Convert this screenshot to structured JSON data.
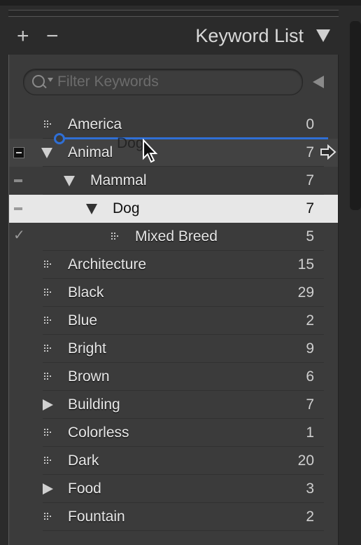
{
  "header": {
    "add_label": "+",
    "remove_label": "−",
    "title": "Keyword List"
  },
  "filter": {
    "placeholder": "Filter Keywords"
  },
  "drag": {
    "ghost_label": "Dog"
  },
  "colors": {
    "accent": "#2f6fd6",
    "panel": "#3b3b3b",
    "selected_row": "#e7e7e7"
  },
  "keywords": [
    {
      "name": "America",
      "count": "0",
      "depth": 0,
      "icon": "dots-icon",
      "status": "none"
    },
    {
      "name": "Animal",
      "count": "7",
      "depth": 0,
      "icon": "triangle-down-icon",
      "status": "minus-box"
    },
    {
      "name": "Mammal",
      "count": "7",
      "depth": 1,
      "icon": "triangle-down-icon",
      "status": "minus"
    },
    {
      "name": "Dog",
      "count": "7",
      "depth": 2,
      "icon": "triangle-down-icon",
      "status": "minus",
      "selected": true
    },
    {
      "name": "Mixed Breed",
      "count": "5",
      "depth": 3,
      "icon": "dots-icon",
      "status": "check"
    },
    {
      "name": "Architecture",
      "count": "15",
      "depth": 0,
      "icon": "dots-icon",
      "status": "none"
    },
    {
      "name": "Black",
      "count": "29",
      "depth": 0,
      "icon": "dots-icon",
      "status": "none"
    },
    {
      "name": "Blue",
      "count": "2",
      "depth": 0,
      "icon": "dots-icon",
      "status": "none"
    },
    {
      "name": "Bright",
      "count": "9",
      "depth": 0,
      "icon": "dots-icon",
      "status": "none"
    },
    {
      "name": "Brown",
      "count": "6",
      "depth": 0,
      "icon": "dots-icon",
      "status": "none"
    },
    {
      "name": "Building",
      "count": "7",
      "depth": 0,
      "icon": "triangle-right-icon",
      "status": "none"
    },
    {
      "name": "Colorless",
      "count": "1",
      "depth": 0,
      "icon": "dots-icon",
      "status": "none"
    },
    {
      "name": "Dark",
      "count": "20",
      "depth": 0,
      "icon": "dots-icon",
      "status": "none"
    },
    {
      "name": "Food",
      "count": "3",
      "depth": 0,
      "icon": "triangle-right-icon",
      "status": "none"
    },
    {
      "name": "Fountain",
      "count": "2",
      "depth": 0,
      "icon": "dots-icon",
      "status": "none"
    }
  ]
}
